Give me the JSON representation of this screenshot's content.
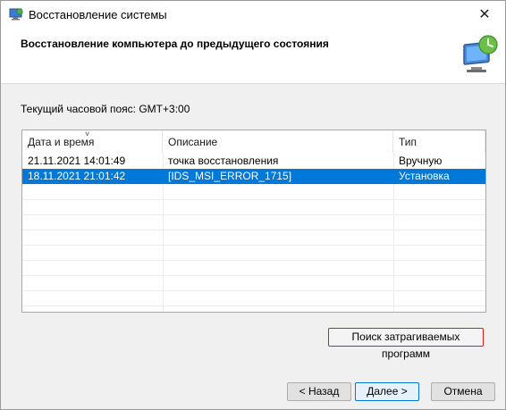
{
  "window": {
    "title": "Восстановление системы",
    "close_glyph": "✕"
  },
  "header": {
    "title": "Восстановление компьютера до предыдущего состояния",
    "icon": "system-restore-monitor-icon"
  },
  "timezone_label": "Текущий часовой пояс: GMT+3:00",
  "list": {
    "columns": [
      "Дата и время",
      "Описание",
      "Тип"
    ],
    "sort_glyph": "˅",
    "rows": [
      {
        "date": "21.11.2021 14:01:49",
        "description": "точка восстановления",
        "type": "Вручную",
        "selected": false
      },
      {
        "date": "18.11.2021 21:01:42",
        "description": "[IDS_MSI_ERROR_1715]",
        "type": "Установка",
        "selected": true
      }
    ]
  },
  "buttons": {
    "affected_programs": "Поиск затрагиваемых программ",
    "back": "< Назад",
    "next": "Далее >",
    "cancel": "Отмена"
  },
  "colors": {
    "selection": "#0078d7",
    "highlight_border": "#e01a1a"
  }
}
